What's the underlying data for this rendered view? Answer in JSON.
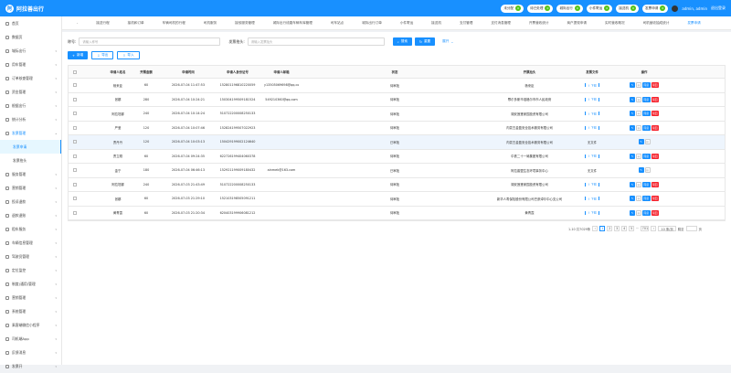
{
  "brand": "阿拉善出行",
  "top_pills": [
    {
      "label": "未分配",
      "count": "0"
    },
    {
      "label": "待已处理",
      "count": "0"
    },
    {
      "label": "城际出行",
      "count": "0"
    },
    {
      "label": "小件寄运",
      "count": "0"
    },
    {
      "label": "接送机",
      "count": "0"
    },
    {
      "label": "发票申请",
      "count": "0"
    }
  ],
  "user": {
    "name": "admin, admin",
    "logout": "退出登录"
  },
  "sidebar": {
    "items": [
      "首页",
      "数据页",
      "城际出行",
      "用车管理",
      "订单核查管理",
      "资金管理",
      "根据出行",
      "统计分析",
      "发票管理"
    ],
    "sub": [
      "发票申请",
      "发票抬头"
    ],
    "items2": [
      "服务管理",
      "营销管理",
      "投诉退款",
      "退款退账",
      "租车服务",
      "车辆信息管理",
      "驾驶员管理",
      "定位监控",
      "制度(通用)管理",
      "营销管理",
      "系统管理",
      "乘客端微信小程序",
      "司机端App",
      "反馈消息",
      "发票开"
    ]
  },
  "tabs": [
    "-",
    "接送行程",
    "接机和订单",
    "车辆司机的行程",
    "司机服务",
    "接驳服务管理",
    "城际出行线路车辆车库管理",
    "司车站点",
    "城际出行订单",
    "小件寄运",
    "接送机",
    "支付管理",
    "支付消息管理",
    "开票营收统计",
    "商户提现申请",
    "实时营收概况",
    "司机营收抽成统计",
    "发票申请"
  ],
  "search": {
    "label1": "称号:",
    "ph1": "请输入称号",
    "label2": "发票抬头:",
    "ph2": "请输入发票抬头",
    "search_btn": "搜索",
    "reset_btn": "重置",
    "expand": "展开"
  },
  "toolbar": {
    "add": "新增",
    "export": "导出",
    "import": "导入"
  },
  "columns": [
    "申请人姓名",
    "开票金额",
    "申请时间",
    "申请人身份证号",
    "申请人邮箱",
    "状态",
    "开票抬头",
    "发票文件",
    "操作"
  ],
  "rows": [
    {
      "name": "杨来臣",
      "amount": "60",
      "time": "2026-07-04 11:47:53",
      "id": "152801196810220059",
      "email": "y13505069698@qq.com",
      "status": "待审批",
      "title": "杨来臣",
      "file": "dl",
      "ops": "full"
    },
    {
      "name": "张娜",
      "amount": "280",
      "time": "2026-07-04 10:24:21",
      "id": "150304199509181524",
      "email": "549210360@qq.com",
      "status": "待审批",
      "title": "鄂尔多斯市准格尔市市人民政府",
      "file": "dl",
      "ops": "full"
    },
    {
      "name": "阿拉坦娜",
      "amount": "240",
      "time": "2026-07-04 10:14:24",
      "id": "510722200008250133",
      "email": "",
      "status": "待审批",
      "title": "湖安莲蓬家园投资有限公司",
      "file": "dl",
      "ops": "full"
    },
    {
      "name": "严莹",
      "amount": "120",
      "time": "2026-07-04 10:07:46",
      "id": "152824199507022923",
      "email": "",
      "status": "待审批",
      "title": "内蒙古金盈安全技术服务有限公司",
      "file": "dl",
      "ops": "full"
    },
    {
      "name": "贾丹丹",
      "amount": "120",
      "time": "2026-07-04 10:03:13",
      "id": "150429199002124640",
      "email": "",
      "status": "已审批",
      "title": "内蒙古金盈安全技术服务有限公司",
      "file": "无文件",
      "ops": "lite"
    },
    {
      "name": "贾立刚",
      "amount": "60",
      "time": "2026-07-04 09:24:35",
      "id": "622726199404060378",
      "email": "",
      "status": "待审批",
      "title": "中铁二十一局集团有限公司",
      "file": "dl",
      "ops": "full"
    },
    {
      "name": "金宁",
      "amount": "180",
      "time": "2026-07-04 06:46:13",
      "id": "152921199009180432",
      "email": "ainmek@163.com",
      "status": "已审批",
      "title": "阿拉善盟生态环境事务中心",
      "file": "无文件",
      "ops": "lite"
    },
    {
      "name": "阿拉坦娜",
      "amount": "240",
      "time": "2026-07-03 21:43:49",
      "id": "510722200008250133",
      "email": "",
      "status": "待审批",
      "title": "湖安莲蓬家园投资有限公司",
      "file": "dl",
      "ops": "full"
    },
    {
      "name": "张娜",
      "amount": "60",
      "time": "2026-07-03 21:29:10",
      "id": "152103198505091211",
      "email": "",
      "status": "待审批",
      "title": "新华人寿保险股份有限公司巴彦淖尔中心支公司",
      "file": "dl",
      "ops": "full"
    },
    {
      "name": "黄青霞",
      "amount": "60",
      "time": "2026-07-03 21:20:34",
      "id": "620403199906081212",
      "email": "",
      "status": "待审批",
      "title": "黄青霞",
      "file": "dl",
      "ops": "full"
    }
  ],
  "labels": {
    "download": "下载",
    "no_file": "无文件",
    "pass": "同意",
    "reject": "驳回"
  },
  "pager": {
    "total": "1-10 共7029条",
    "pages": [
      "1",
      "2",
      "3",
      "4",
      "5",
      "···",
      "701"
    ],
    "size": "10 条/页",
    "goto": "跳至",
    "page": "页"
  }
}
